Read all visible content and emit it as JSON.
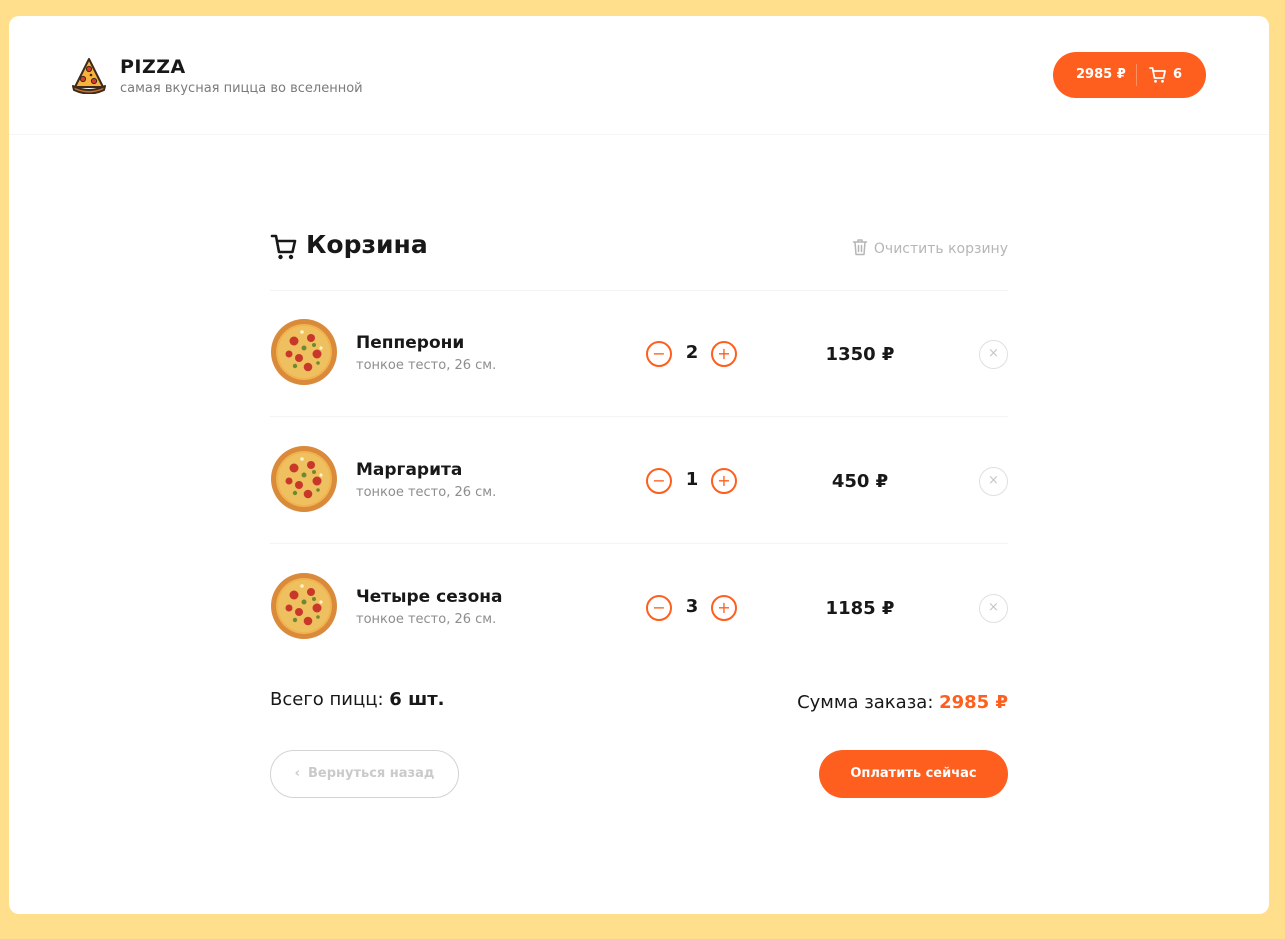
{
  "header": {
    "brand_title": "PIZZA",
    "brand_subtitle": "самая вкусная пицца во вселенной",
    "logo_icon": "pizza-slice-icon",
    "cart_button": {
      "total": "2985 ₽",
      "count": "6",
      "icon": "cart-icon"
    }
  },
  "cart": {
    "title": "Корзина",
    "title_icon": "cart-icon",
    "clear_label": "Очистить корзину",
    "clear_icon": "trash-icon",
    "items": [
      {
        "name": "Пепперони",
        "desc": "тонкое тесто, 26 см.",
        "qty": "2",
        "price": "1350 ₽",
        "minus": "−",
        "plus": "+",
        "remove": "×"
      },
      {
        "name": "Маргарита",
        "desc": "тонкое тесто, 26 см.",
        "qty": "1",
        "price": "450 ₽",
        "minus": "−",
        "plus": "+",
        "remove": "×"
      },
      {
        "name": "Четыре сезона",
        "desc": "тонкое тесто, 26 см.",
        "qty": "3",
        "price": "1185 ₽",
        "minus": "−",
        "plus": "+",
        "remove": "×"
      }
    ],
    "summary": {
      "count_label": "Всего пицц: ",
      "count_value": "6 шт.",
      "sum_label": "Сумма заказа: ",
      "sum_value": "2985 ₽"
    },
    "back_label": "Вернуться назад",
    "pay_label": "Оплатить сейчас"
  },
  "colors": {
    "background": "#ffdf8c",
    "accent": "#fe5f1e",
    "text": "#181818",
    "muted": "#8d8d8d"
  }
}
